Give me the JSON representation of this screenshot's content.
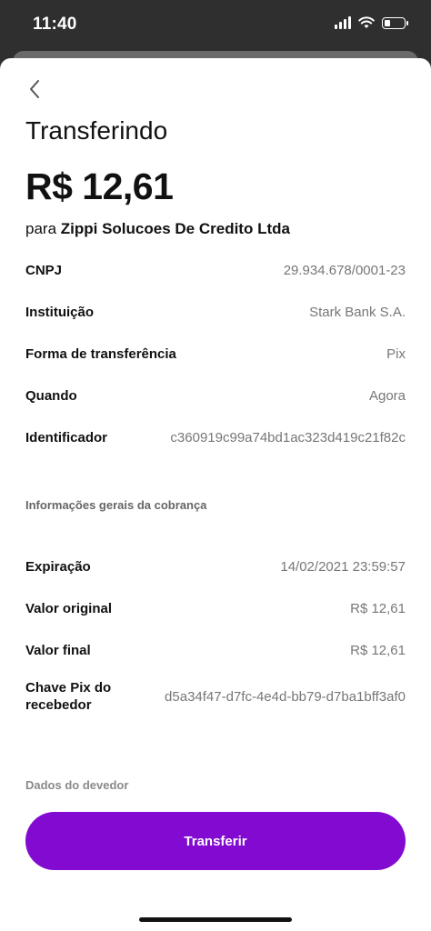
{
  "status_bar": {
    "time": "11:40"
  },
  "screen": {
    "title": "Transferindo",
    "amount": "R$ 12,61",
    "recipient_prefix": "para",
    "recipient_name": "Zippi Solucoes De Credito Ltda"
  },
  "details": [
    {
      "label": "CNPJ",
      "value": "29.934.678/0001-23"
    },
    {
      "label": "Instituição",
      "value": "Stark Bank S.A."
    },
    {
      "label": "Forma de transferência",
      "value": "Pix"
    },
    {
      "label": "Quando",
      "value": "Agora"
    },
    {
      "label": "Identificador",
      "value": "c360919c99a74bd1ac323d419c21f82c"
    }
  ],
  "section_charge": {
    "title": "Informações gerais da cobrança"
  },
  "charge": [
    {
      "label": "Expiração",
      "value": "14/02/2021 23:59:57"
    },
    {
      "label": "Valor original",
      "value": "R$ 12,61"
    },
    {
      "label": "Valor final",
      "value": "R$ 12,61"
    },
    {
      "label": "Chave Pix do recebedor",
      "value": "d5a34f47-d7fc-4e4d-bb79-d7ba1bff3af0"
    }
  ],
  "section_debtor": {
    "title": "Dados do devedor"
  },
  "actions": {
    "transfer_label": "Transferir"
  },
  "colors": {
    "primary": "#820ad1",
    "status_bar": "#2f2f2f"
  },
  "icons": {
    "back": "chevron-left-icon",
    "signal": "cellular-signal-icon",
    "wifi": "wifi-icon",
    "battery": "battery-icon"
  }
}
